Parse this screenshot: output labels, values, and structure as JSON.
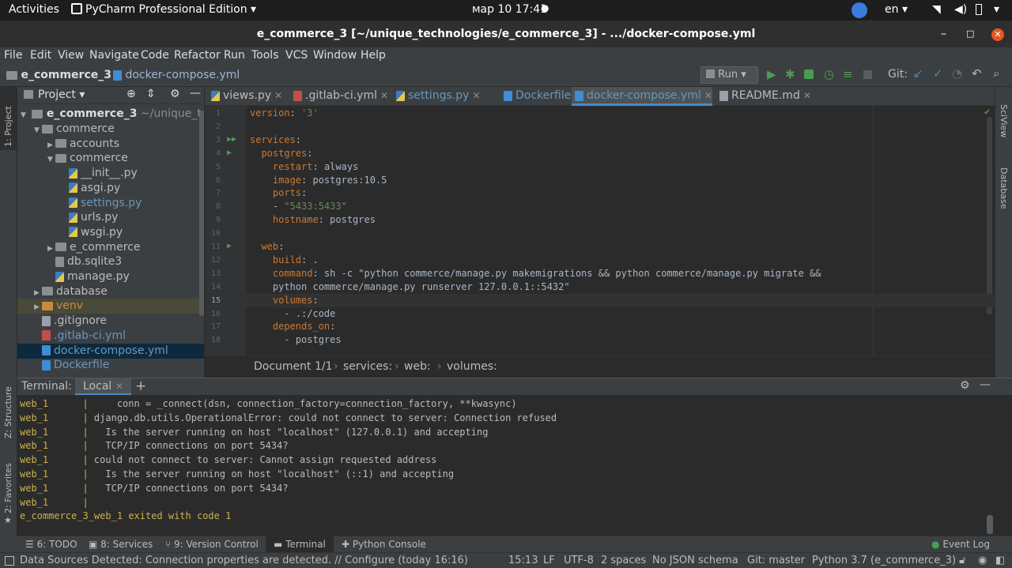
{
  "os_topbar": {
    "activities": "Activities",
    "app_name": "PyCharm Professional Edition",
    "clock": "мар 10  17:41",
    "lang": "en"
  },
  "window": {
    "title": "e_commerce_3 [~/unique_technologies/e_commerce_3] - .../docker-compose.yml"
  },
  "menu": [
    "File",
    "Edit",
    "View",
    "Navigate",
    "Code",
    "Refactor",
    "Run",
    "Tools",
    "VCS",
    "Window",
    "Help"
  ],
  "navbar": {
    "project": "e_commerce_3",
    "file": "docker-compose.yml",
    "run_label": "Run",
    "git_label": "Git:"
  },
  "project_panel": {
    "title": "Project",
    "root_name": "e_commerce_3",
    "root_path": "~/unique_techno",
    "items": [
      {
        "label": "commerce",
        "type": "folder",
        "depth": 1,
        "expanded": true
      },
      {
        "label": "accounts",
        "type": "folder",
        "depth": 2,
        "expanded": false
      },
      {
        "label": "commerce",
        "type": "folder",
        "depth": 2,
        "expanded": true
      },
      {
        "label": "__init__.py",
        "type": "py",
        "depth": 3
      },
      {
        "label": "asgi.py",
        "type": "py",
        "depth": 3
      },
      {
        "label": "settings.py",
        "type": "py",
        "depth": 3
      },
      {
        "label": "urls.py",
        "type": "py",
        "depth": 3
      },
      {
        "label": "wsgi.py",
        "type": "py",
        "depth": 3
      },
      {
        "label": "e_commerce",
        "type": "folder",
        "depth": 2,
        "expanded": false
      },
      {
        "label": "db.sqlite3",
        "type": "db",
        "depth": 2
      },
      {
        "label": "manage.py",
        "type": "py",
        "depth": 2
      },
      {
        "label": "database",
        "type": "folder",
        "depth": 1,
        "expanded": false
      },
      {
        "label": "venv",
        "type": "folder",
        "depth": 1,
        "expanded": false
      },
      {
        "label": ".gitignore",
        "type": "gen",
        "depth": 1
      },
      {
        "label": ".gitlab-ci.yml",
        "type": "yml",
        "depth": 1
      },
      {
        "label": "docker-compose.yml",
        "type": "docker",
        "depth": 1
      },
      {
        "label": "Dockerfile",
        "type": "docker",
        "depth": 1
      }
    ]
  },
  "left_strip": {
    "project": "1: Project",
    "structure": "Z: Structure",
    "favorites": "2: Favorites"
  },
  "right_strip": {
    "sciview": "SciView",
    "database": "Database"
  },
  "tabs": [
    {
      "label": "views.py",
      "active": false
    },
    {
      "label": ".gitlab-ci.yml",
      "active": false
    },
    {
      "label": "settings.py",
      "active": false
    },
    {
      "label": "Dockerfile",
      "active": false
    },
    {
      "label": "docker-compose.yml",
      "active": true
    },
    {
      "label": "README.md",
      "active": false
    }
  ],
  "editor": {
    "lines": [
      {
        "n": "1",
        "indent": "",
        "key": "version",
        "sep": ": ",
        "val": "'3'",
        "vtype": "s"
      },
      {
        "n": "2",
        "indent": "",
        "key": "",
        "sep": "",
        "val": "",
        "vtype": "v"
      },
      {
        "n": "3",
        "indent": "",
        "key": "services",
        "sep": ":",
        "val": "",
        "vtype": "v"
      },
      {
        "n": "4",
        "indent": "  ",
        "key": "postgres",
        "sep": ":",
        "val": "",
        "vtype": "v"
      },
      {
        "n": "5",
        "indent": "    ",
        "key": "restart",
        "sep": ": ",
        "val": "always",
        "vtype": "v"
      },
      {
        "n": "6",
        "indent": "    ",
        "key": "image",
        "sep": ": ",
        "val": "postgres:10.5",
        "vtype": "v"
      },
      {
        "n": "7",
        "indent": "    ",
        "key": "ports",
        "sep": ":",
        "val": "",
        "vtype": "v"
      },
      {
        "n": "8",
        "indent": "    ",
        "key": "",
        "sep": "- ",
        "val": "\"5433:5433\"",
        "vtype": "s"
      },
      {
        "n": "9",
        "indent": "    ",
        "key": "hostname",
        "sep": ": ",
        "val": "postgres",
        "vtype": "v"
      },
      {
        "n": "10",
        "indent": "",
        "key": "",
        "sep": "",
        "val": "",
        "vtype": "v"
      },
      {
        "n": "11",
        "indent": "  ",
        "key": "web",
        "sep": ":",
        "val": "",
        "vtype": "v"
      },
      {
        "n": "12",
        "indent": "    ",
        "key": "build",
        "sep": ": ",
        "val": ".",
        "vtype": "v"
      },
      {
        "n": "13",
        "indent": "    ",
        "key": "command",
        "sep": ": ",
        "val": "sh -c \"python commerce/manage.py makemigrations && python commerce/manage.py migrate &&",
        "vtype": "v"
      },
      {
        "n": "14",
        "indent": "    ",
        "key": "",
        "sep": "",
        "val": "python commerce/manage.py runserver 127.0.0.1::5432\"",
        "vtype": "v"
      },
      {
        "n": "15",
        "indent": "    ",
        "key": "volumes",
        "sep": ":",
        "val": "",
        "vtype": "v"
      },
      {
        "n": "16",
        "indent": "      ",
        "key": "",
        "sep": "- ",
        "val": ".:/code",
        "vtype": "v"
      },
      {
        "n": "17",
        "indent": "    ",
        "key": "depends_on",
        "sep": ":",
        "val": "",
        "vtype": "v"
      },
      {
        "n": "18",
        "indent": "      ",
        "key": "",
        "sep": "- ",
        "val": "postgres",
        "vtype": "v"
      }
    ],
    "current_line": "15"
  },
  "breadcrumbs": [
    "Document 1/1",
    "services:",
    "web:",
    "volumes:"
  ],
  "terminal": {
    "label": "Terminal:",
    "tab": "Local",
    "lines": [
      {
        "svc": "web_1",
        "sep": "      |",
        "text": "     conn = _connect(dsn, connection_factory=connection_factory, **kwasync)"
      },
      {
        "svc": "web_1",
        "sep": "      |",
        "text": " django.db.utils.OperationalError: could not connect to server: Connection refused"
      },
      {
        "svc": "web_1",
        "sep": "      |",
        "text": "   Is the server running on host \"localhost\" (127.0.0.1) and accepting"
      },
      {
        "svc": "web_1",
        "sep": "      |",
        "text": "   TCP/IP connections on port 5434?"
      },
      {
        "svc": "web_1",
        "sep": "      |",
        "text": " could not connect to server: Cannot assign requested address"
      },
      {
        "svc": "web_1",
        "sep": "      |",
        "text": "   Is the server running on host \"localhost\" (::1) and accepting"
      },
      {
        "svc": "web_1",
        "sep": "      |",
        "text": "   TCP/IP connections on port 5434?"
      },
      {
        "svc": "web_1",
        "sep": "      |",
        "text": ""
      }
    ],
    "exit_line": "e_commerce_3_web_1 exited with code 1"
  },
  "tool_windows": [
    {
      "label": "6: TODO"
    },
    {
      "label": "8: Services"
    },
    {
      "label": "9: Version Control"
    },
    {
      "label": "Terminal",
      "active": true
    },
    {
      "label": "Python Console"
    }
  ],
  "event_log": "Event Log",
  "status": {
    "message": "Data Sources Detected: Connection properties are detected. // Configure (today 16:16)",
    "position": "15:13",
    "line_sep": "LF",
    "encoding": "UTF-8",
    "indent": "2 spaces",
    "schema": "No JSON schema",
    "git": "Git: master",
    "interpreter": "Python 3.7 (e_commerce_3)"
  },
  "colors": {
    "accent": "#4a88c7",
    "keyword": "#cc7832",
    "string": "#6a8759",
    "run_green": "#499c54",
    "svc_yellow": "#cdb24f"
  }
}
